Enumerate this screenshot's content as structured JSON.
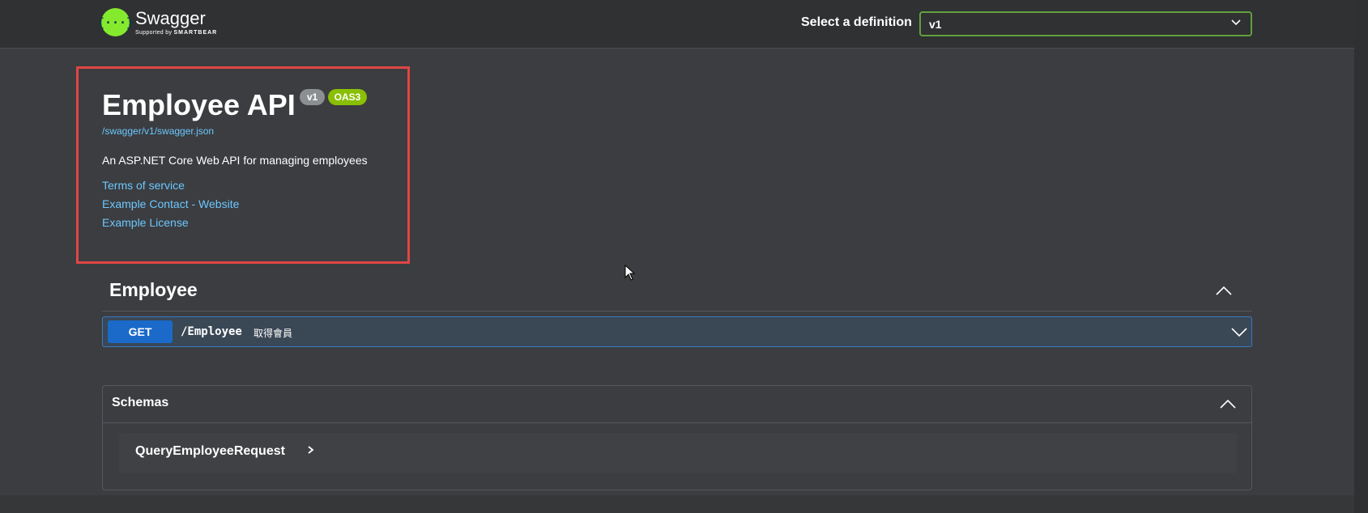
{
  "header": {
    "logo_icon_text": "{···}",
    "logo_name": "Swagger",
    "logo_sub_prefix": "Supported by",
    "logo_sub_brand": "SMARTBEAR",
    "definition_label": "Select a definition",
    "definition_value": "v1"
  },
  "info": {
    "title": "Employee API",
    "version_badge": "v1",
    "oas_badge": "OAS3",
    "spec_url": "/swagger/v1/swagger.json",
    "description": "An ASP.NET Core Web API for managing employees",
    "links": [
      "Terms of service",
      "Example Contact - Website",
      "Example License"
    ]
  },
  "tag": {
    "name": "Employee",
    "operations": [
      {
        "method": "GET",
        "path": "/Employee",
        "summary": "取得會員"
      }
    ]
  },
  "schemas": {
    "title": "Schemas",
    "models": [
      "QueryEmployeeRequest"
    ]
  },
  "colors": {
    "background": "#3b3d40",
    "get_method": "#1b6ac9",
    "link": "#6cc7ff",
    "highlight_border": "#e04545",
    "oas_badge": "#89bf04",
    "swagger_green": "#85ea2d"
  }
}
